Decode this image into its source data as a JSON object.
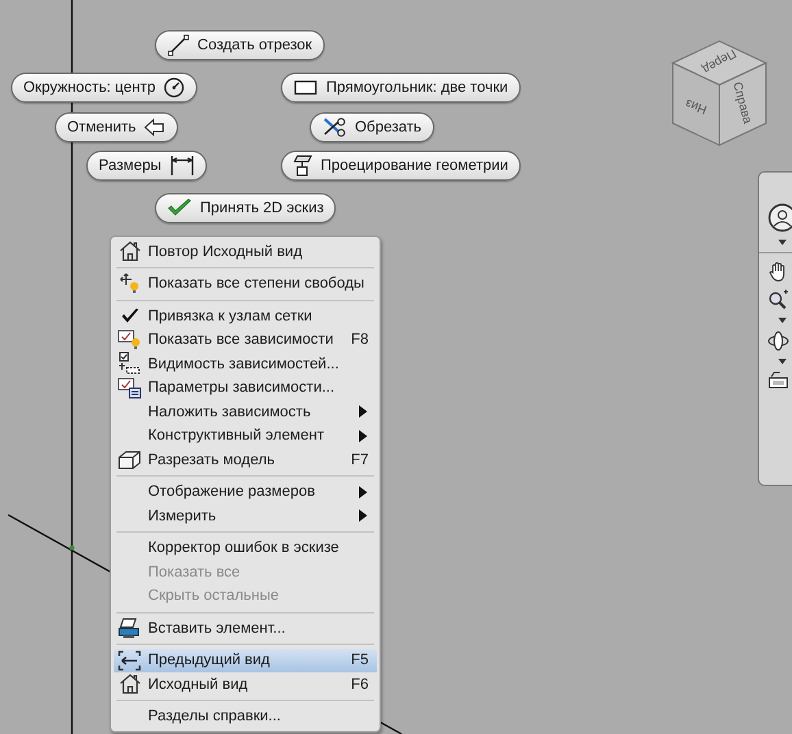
{
  "marking_menu": [
    {
      "label": "Создать отрезок"
    },
    {
      "label": "Окружность: центр"
    },
    {
      "label": "Прямоугольник: две точки"
    },
    {
      "label": "Отменить"
    },
    {
      "label": "Обрезать"
    },
    {
      "label": "Размеры"
    },
    {
      "label": "Проецирование геометрии"
    },
    {
      "label": "Принять 2D эскиз"
    }
  ],
  "view_cube": {
    "faces": [
      "Перед",
      "Справа",
      "Низ"
    ]
  },
  "context_menu": {
    "sections": [
      [
        {
          "label": "Повтор Исходный вид",
          "checked": false,
          "submenu": false,
          "disabled": false,
          "selected": false
        }
      ],
      [
        {
          "label": "Показать все степени свободы",
          "checked": false,
          "submenu": false,
          "disabled": false,
          "selected": false
        }
      ],
      [
        {
          "label": "Привязка к узлам сетки",
          "checked": true,
          "submenu": false,
          "disabled": false,
          "selected": false
        },
        {
          "label": "Показать все зависимости",
          "shortcut": "F8",
          "checked": false,
          "submenu": false,
          "disabled": false,
          "selected": false
        },
        {
          "label": "Видимость зависимостей...",
          "checked": false,
          "submenu": false,
          "disabled": false,
          "selected": false
        },
        {
          "label": "Параметры зависимости...",
          "checked": false,
          "submenu": false,
          "disabled": false,
          "selected": false
        },
        {
          "label": "Наложить зависимость",
          "checked": false,
          "submenu": true,
          "disabled": false,
          "selected": false
        },
        {
          "label": "Конструктивный элемент",
          "checked": false,
          "submenu": true,
          "disabled": false,
          "selected": false
        },
        {
          "label": "Разрезать модель",
          "shortcut": "F7",
          "checked": false,
          "submenu": false,
          "disabled": false,
          "selected": false
        }
      ],
      [
        {
          "label": "Отображение размеров",
          "checked": false,
          "submenu": true,
          "disabled": false,
          "selected": false
        },
        {
          "label": "Измерить",
          "checked": false,
          "submenu": true,
          "disabled": false,
          "selected": false
        }
      ],
      [
        {
          "label": "Корректор ошибок в эскизе",
          "checked": false,
          "submenu": false,
          "disabled": false,
          "selected": false
        },
        {
          "label": "Показать все",
          "checked": false,
          "submenu": false,
          "disabled": true,
          "selected": false
        },
        {
          "label": "Скрыть остальные",
          "checked": false,
          "submenu": false,
          "disabled": true,
          "selected": false
        }
      ],
      [
        {
          "label": "Вставить элемент...",
          "checked": false,
          "submenu": false,
          "disabled": false,
          "selected": false
        }
      ],
      [
        {
          "label": "Предыдущий вид",
          "shortcut": "F5",
          "checked": false,
          "submenu": false,
          "disabled": false,
          "selected": true
        },
        {
          "label": "Исходный вид",
          "shortcut": "F6",
          "checked": false,
          "submenu": false,
          "disabled": false,
          "selected": false
        }
      ],
      [
        {
          "label": "Разделы справки...",
          "checked": false,
          "submenu": false,
          "disabled": false,
          "selected": false
        }
      ]
    ]
  }
}
